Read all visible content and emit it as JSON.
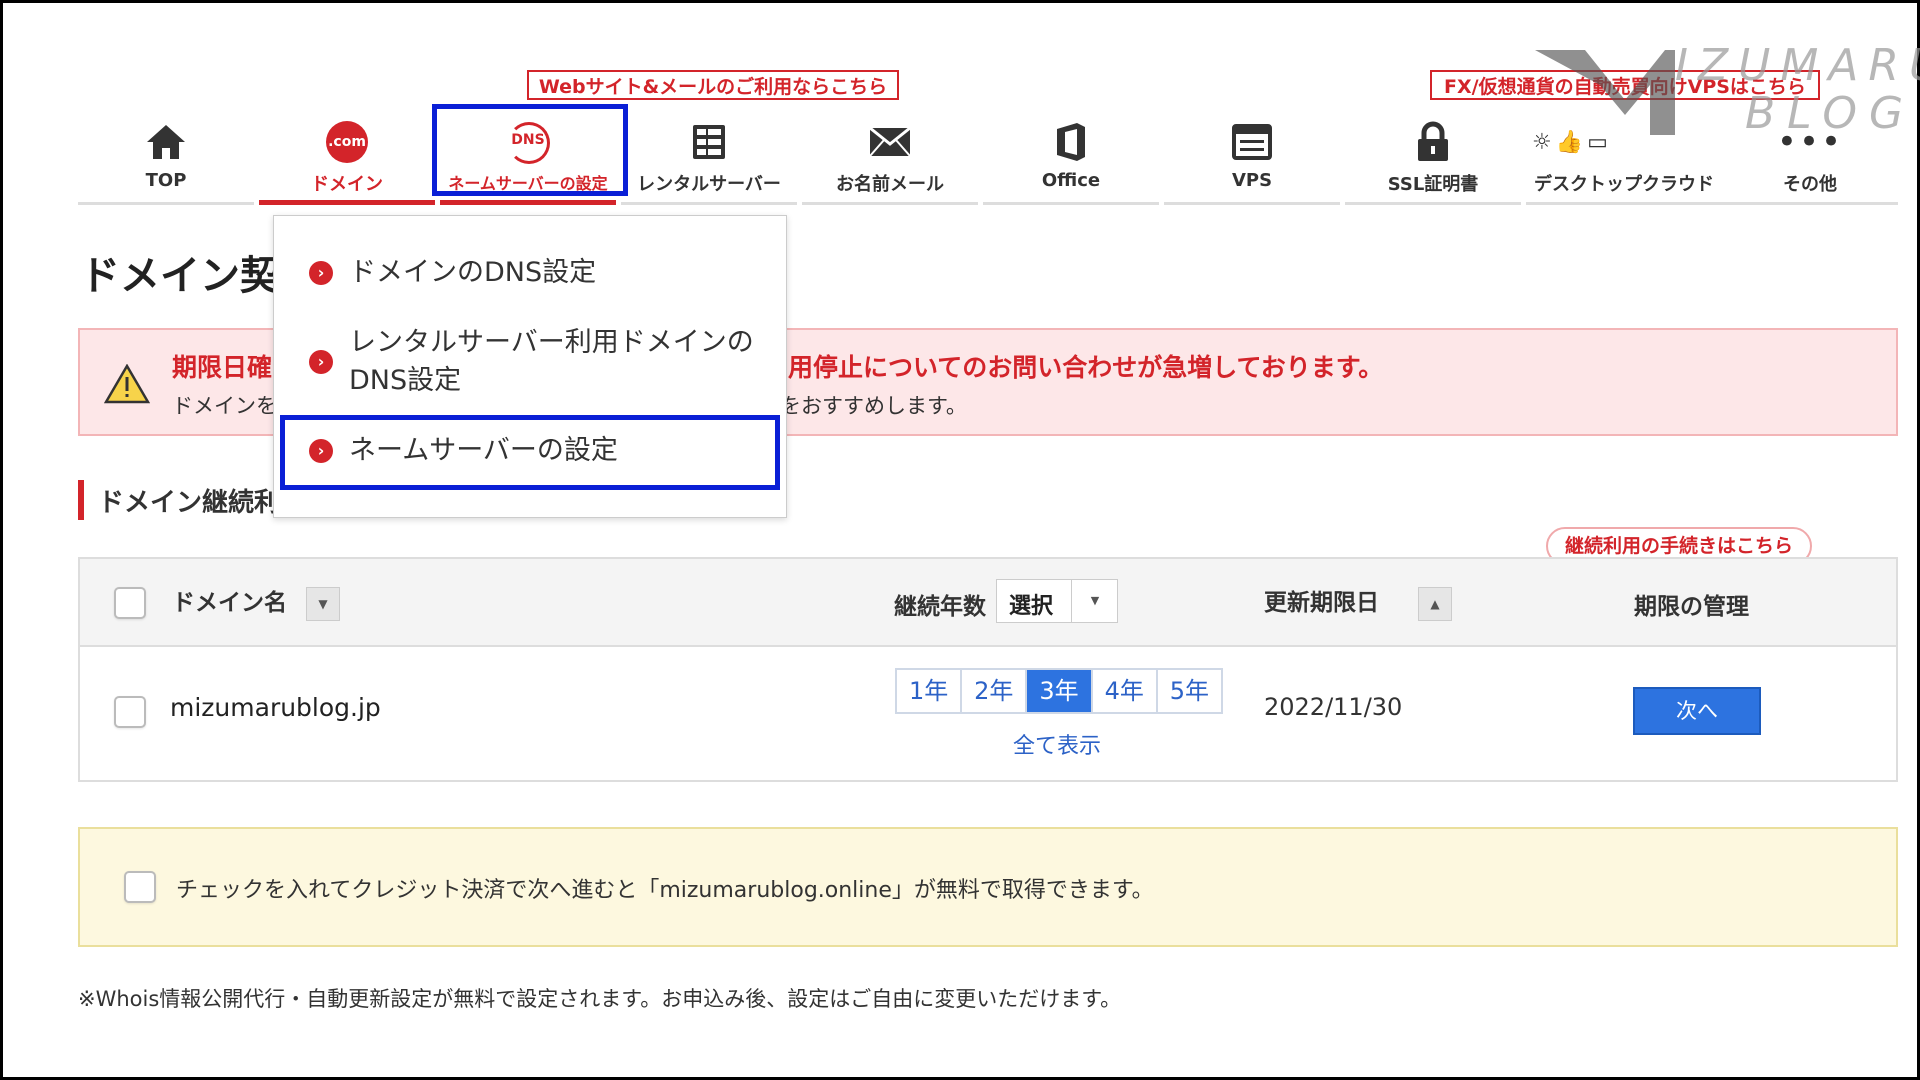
{
  "nav": {
    "callout_left": "Webサイト&メールのご利用ならこちら",
    "callout_right": "FX/仮想通貨の自動売買向けVPSはこちら",
    "items": [
      {
        "label": "TOP"
      },
      {
        "label": "ドメイン",
        "icon_text": ".com"
      },
      {
        "label": "ネームサーバーの設定",
        "icon_text": "DNS"
      },
      {
        "label": "レンタルサーバー"
      },
      {
        "label": "お名前メール"
      },
      {
        "label": "Office"
      },
      {
        "label": "VPS"
      },
      {
        "label": "SSL証明書"
      },
      {
        "label": "デスクトップクラウド"
      },
      {
        "label": "その他"
      }
    ]
  },
  "dropdown": {
    "items": [
      {
        "label": "ドメインのDNS設定"
      },
      {
        "label_line1": "レンタルサーバー利用ドメインの",
        "label_line2": "DNS設定"
      },
      {
        "label": "ネームサーバーの設定"
      }
    ]
  },
  "page": {
    "title": "ドメイン契",
    "warning_title_prefix": "期限日確",
    "warning_title_suffix": "用停止についてのお問い合わせが急増しております。",
    "warning_body_prefix": "ドメインを",
    "warning_body_suffix": "をおすすめします。",
    "section_title": "ドメイン継続利",
    "tip": "継続利用の手続きはこちら"
  },
  "table": {
    "headers": {
      "domain": "ドメイン名",
      "years": "継続年数",
      "years_select": "選択",
      "expiry": "更新期限日",
      "manage": "期限の管理"
    },
    "row": {
      "domain": "mizumarublog.jp",
      "year_options": [
        "1年",
        "2年",
        "3年",
        "4年",
        "5年"
      ],
      "selected_year": "3年",
      "show_all": "全て表示",
      "expiry": "2022/11/30",
      "next_label": "次へ"
    }
  },
  "notice": {
    "text": "チェックを入れてクレジット決済で次へ進むと「mizumarublog.online」が無料で取得できます。"
  },
  "footer_note": "※Whois情報公開代行・自動更新設定が無料で設定されます。お申込み後、設定はご自由に変更いただけます。",
  "watermark": {
    "line1": "IZUMARU",
    "line2": "BLOG"
  },
  "colors": {
    "brand_red": "#d3242a",
    "highlight_blue": "#0a1fd6",
    "button_blue": "#2d73e0"
  }
}
